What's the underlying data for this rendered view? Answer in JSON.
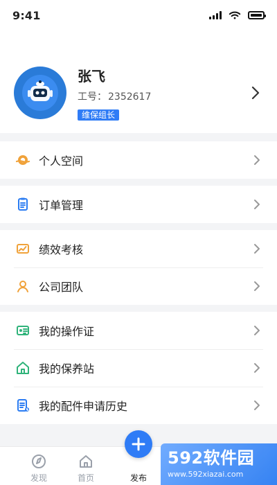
{
  "status_bar": {
    "time": "9:41"
  },
  "profile": {
    "name": "张飞",
    "employee_no_label": "工号：",
    "employee_no_value": "2352617",
    "badge": "维保组长",
    "avatar_icon": "robot-avatar-icon"
  },
  "menu": {
    "sections": [
      {
        "items": [
          {
            "label": "个人空间",
            "icon": "personal-space-icon",
            "color": "#f0a23a"
          }
        ]
      },
      {
        "items": [
          {
            "label": "订单管理",
            "icon": "order-clipboard-icon",
            "color": "#2b7cf2"
          }
        ]
      },
      {
        "items": [
          {
            "label": "绩效考核",
            "icon": "performance-chart-icon",
            "color": "#f0a23a"
          },
          {
            "label": "公司团队",
            "icon": "team-person-icon",
            "color": "#f0a23a"
          }
        ]
      },
      {
        "items": [
          {
            "label": "我的操作证",
            "icon": "id-card-icon",
            "color": "#2fb37a"
          },
          {
            "label": "我的保养站",
            "icon": "home-station-icon",
            "color": "#2fb37a"
          },
          {
            "label": "我的配件申请历史",
            "icon": "parts-history-icon",
            "color": "#2b7cf2"
          }
        ]
      }
    ]
  },
  "tab_bar": {
    "tabs": [
      {
        "label": "发现",
        "icon": "compass-icon"
      },
      {
        "label": "首页",
        "icon": "home-icon"
      },
      {
        "label": "发布",
        "icon": "plus-icon"
      }
    ]
  },
  "watermark": {
    "brand": "592软件园",
    "url": "www.592xiazai.com"
  },
  "colors": {
    "brand": "#2f7cf6",
    "background": "#f3f4f6"
  }
}
